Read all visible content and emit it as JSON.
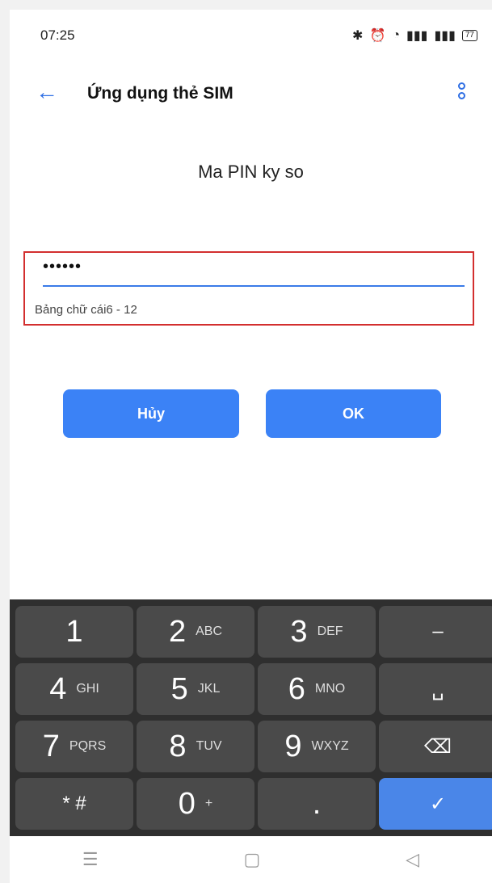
{
  "status": {
    "time": "07:25",
    "icons": [
      "bluetooth-icon",
      "alarm-icon",
      "wifi-icon",
      "signal-3g-icon",
      "signal-4g-icon"
    ],
    "battery": "77"
  },
  "appbar": {
    "title": "Ứng dụng thẻ SIM"
  },
  "dialog": {
    "title": "Ma PIN ky so",
    "pin_value": "••••••",
    "hint": "Bảng chữ cái6 - 12",
    "cancel_label": "Hủy",
    "ok_label": "OK"
  },
  "keyboard": {
    "keys": [
      {
        "num": "1",
        "letters": ""
      },
      {
        "num": "2",
        "letters": "ABC"
      },
      {
        "num": "3",
        "letters": "DEF"
      },
      {
        "num": "–",
        "letters": ""
      },
      {
        "num": "4",
        "letters": "GHI"
      },
      {
        "num": "5",
        "letters": "JKL"
      },
      {
        "num": "6",
        "letters": "MNO"
      },
      {
        "num": "␣",
        "letters": ""
      },
      {
        "num": "7",
        "letters": "PQRS"
      },
      {
        "num": "8",
        "letters": "TUV"
      },
      {
        "num": "9",
        "letters": "WXYZ"
      },
      {
        "num": "⌫",
        "letters": ""
      },
      {
        "num": "* #",
        "letters": ""
      },
      {
        "num": "0",
        "letters": "+"
      },
      {
        "num": ".",
        "letters": ""
      },
      {
        "num": "✓",
        "letters": ""
      }
    ]
  },
  "navbar": {
    "items": [
      "menu-icon",
      "home-icon",
      "back-icon"
    ]
  },
  "colors": {
    "accent": "#3b82f6",
    "highlight_border": "#d32f2f",
    "keyboard_bg": "#2f2f2f"
  }
}
